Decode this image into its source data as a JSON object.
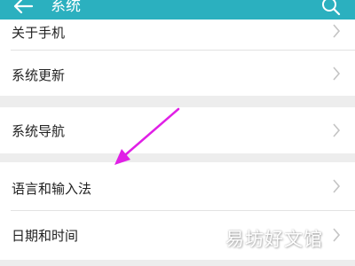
{
  "appbar": {
    "title": "系统",
    "back_icon": "arrow-left-icon",
    "search_icon": "search-icon",
    "color": "#2bb0bf"
  },
  "settings": {
    "items": [
      {
        "label": "关于手机",
        "chevron": "chevron-right-icon"
      },
      {
        "label": "系统更新",
        "chevron": "chevron-right-icon"
      },
      {
        "label": "系统导航",
        "chevron": "chevron-right-icon"
      },
      {
        "label": "语言和输入法",
        "chevron": "chevron-right-icon"
      },
      {
        "label": "日期和时间",
        "chevron": "chevron-right-icon"
      }
    ]
  },
  "annotation": {
    "color": "#e020e6"
  },
  "watermark": {
    "text": "易坊好文馆"
  }
}
